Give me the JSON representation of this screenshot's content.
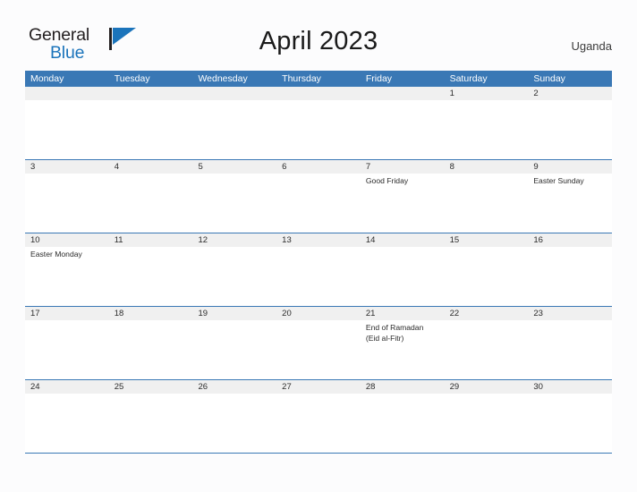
{
  "brand": {
    "name_part1": "General",
    "name_part2": "Blue",
    "logo_icon": "flag-triangle-icon",
    "accent_color": "#1b74bb"
  },
  "header": {
    "title": "April 2023",
    "country": "Uganda"
  },
  "colors": {
    "header_blue": "#3a78b5",
    "date_bar_gray": "#f0f0f0",
    "cell_white": "#ffffff",
    "page_background": "#fcfcfd"
  },
  "calendar": {
    "month": "April",
    "year": "2023",
    "weekday_headers": [
      "Monday",
      "Tuesday",
      "Wednesday",
      "Thursday",
      "Friday",
      "Saturday",
      "Sunday"
    ],
    "weeks": [
      {
        "days": [
          {
            "date": "",
            "events": []
          },
          {
            "date": "",
            "events": []
          },
          {
            "date": "",
            "events": []
          },
          {
            "date": "",
            "events": []
          },
          {
            "date": "",
            "events": []
          },
          {
            "date": "1",
            "events": []
          },
          {
            "date": "2",
            "events": []
          }
        ]
      },
      {
        "days": [
          {
            "date": "3",
            "events": []
          },
          {
            "date": "4",
            "events": []
          },
          {
            "date": "5",
            "events": []
          },
          {
            "date": "6",
            "events": []
          },
          {
            "date": "7",
            "events": [
              "Good Friday"
            ]
          },
          {
            "date": "8",
            "events": []
          },
          {
            "date": "9",
            "events": [
              "Easter Sunday"
            ]
          }
        ]
      },
      {
        "days": [
          {
            "date": "10",
            "events": [
              "Easter Monday"
            ]
          },
          {
            "date": "11",
            "events": []
          },
          {
            "date": "12",
            "events": []
          },
          {
            "date": "13",
            "events": []
          },
          {
            "date": "14",
            "events": []
          },
          {
            "date": "15",
            "events": []
          },
          {
            "date": "16",
            "events": []
          }
        ]
      },
      {
        "days": [
          {
            "date": "17",
            "events": []
          },
          {
            "date": "18",
            "events": []
          },
          {
            "date": "19",
            "events": []
          },
          {
            "date": "20",
            "events": []
          },
          {
            "date": "21",
            "events": [
              "End of Ramadan",
              "(Eid al-Fitr)"
            ]
          },
          {
            "date": "22",
            "events": []
          },
          {
            "date": "23",
            "events": []
          }
        ]
      },
      {
        "days": [
          {
            "date": "24",
            "events": []
          },
          {
            "date": "25",
            "events": []
          },
          {
            "date": "26",
            "events": []
          },
          {
            "date": "27",
            "events": []
          },
          {
            "date": "28",
            "events": []
          },
          {
            "date": "29",
            "events": []
          },
          {
            "date": "30",
            "events": []
          }
        ]
      }
    ]
  }
}
